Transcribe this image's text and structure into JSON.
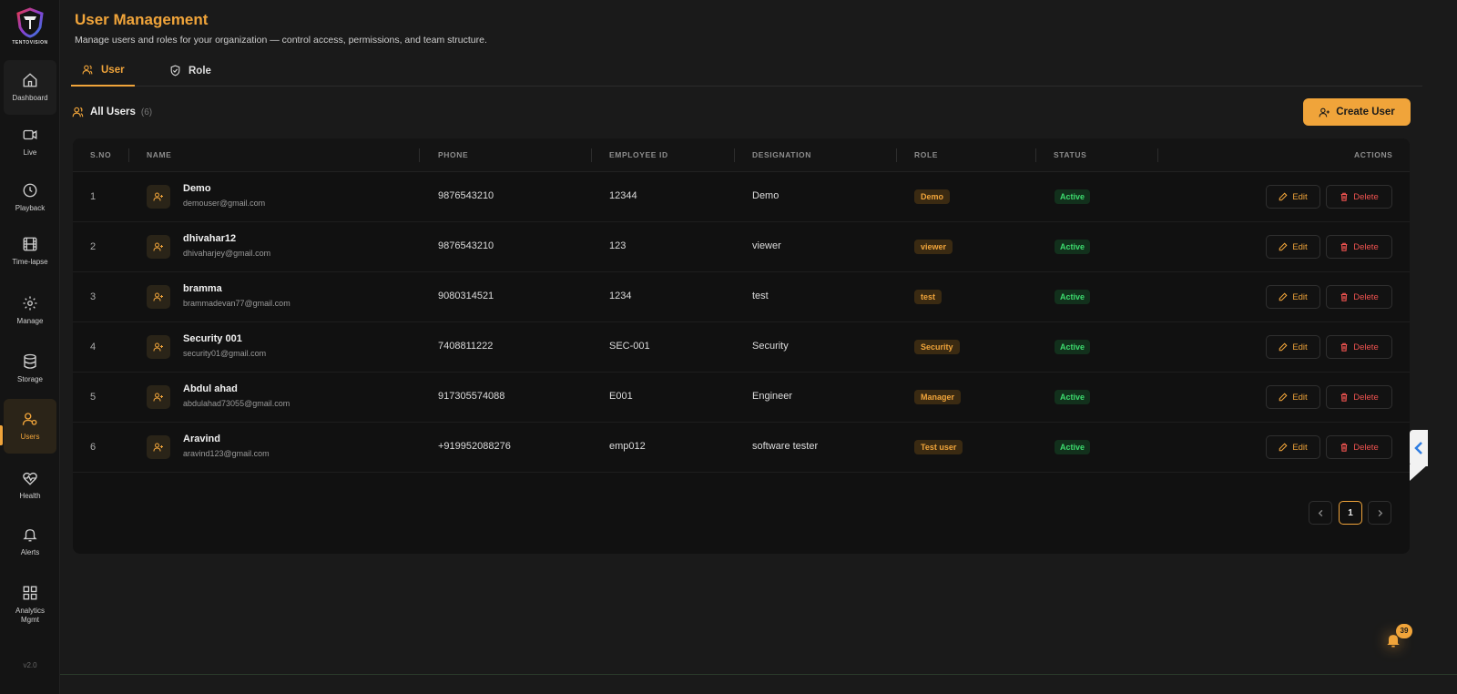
{
  "brand": {
    "logo_text": "TENTOVISION",
    "version": "v2.0"
  },
  "nav": [
    {
      "label": "Dashboard",
      "icon": "home-icon"
    },
    {
      "label": "Live",
      "icon": "video-icon"
    },
    {
      "label": "Playback",
      "icon": "clock-icon"
    },
    {
      "label": "Time-lapse",
      "icon": "film-icon"
    },
    {
      "label": "Manage",
      "icon": "gear-icon"
    },
    {
      "label": "Storage",
      "icon": "database-icon"
    },
    {
      "label": "Users",
      "icon": "users-icon"
    },
    {
      "label": "Health",
      "icon": "heart-pulse-icon"
    },
    {
      "label": "Alerts",
      "icon": "bell-icon"
    },
    {
      "label": "Analytics Mgmt",
      "icon": "grid-icon"
    }
  ],
  "header": {
    "title": "User Management",
    "subtitle": "Manage users and roles for your organization — control access, permissions, and team structure."
  },
  "tabs": {
    "user": "User",
    "role": "Role"
  },
  "list": {
    "heading": "All Users",
    "count": "(6)",
    "create_label": "Create User"
  },
  "columns": {
    "sno": "S.NO",
    "name": "NAME",
    "phone": "PHONE",
    "employee_id": "EMPLOYEE ID",
    "designation": "DESIGNATION",
    "role": "ROLE",
    "status": "STATUS",
    "actions": "ACTIONS"
  },
  "actions": {
    "edit": "Edit",
    "delete": "Delete"
  },
  "users": [
    {
      "sno": "1",
      "name": "Demo",
      "email": "demouser@gmail.com",
      "phone": "9876543210",
      "employee_id": "12344",
      "designation": "Demo",
      "role": "Demo",
      "status": "Active"
    },
    {
      "sno": "2",
      "name": "dhivahar12",
      "email": "dhivaharjey@gmail.com",
      "phone": "9876543210",
      "employee_id": "123",
      "designation": "viewer",
      "role": "viewer",
      "status": "Active"
    },
    {
      "sno": "3",
      "name": "bramma",
      "email": "brammadevan77@gmail.com",
      "phone": "9080314521",
      "employee_id": "1234",
      "designation": "test",
      "role": "test",
      "status": "Active"
    },
    {
      "sno": "4",
      "name": "Security 001",
      "email": "security01@gmail.com",
      "phone": "7408811222",
      "employee_id": "SEC-001",
      "designation": "Security",
      "role": "Security",
      "status": "Active"
    },
    {
      "sno": "5",
      "name": "Abdul ahad",
      "email": "abdulahad73055@gmail.com",
      "phone": "917305574088",
      "employee_id": "E001",
      "designation": "Engineer",
      "role": "Manager",
      "status": "Active"
    },
    {
      "sno": "6",
      "name": "Aravind",
      "email": "aravind123@gmail.com",
      "phone": "+919952088276",
      "employee_id": "emp012",
      "designation": "software tester",
      "role": "Test user",
      "status": "Active"
    }
  ],
  "pagination": {
    "current": "1"
  },
  "notifications": {
    "count": "39"
  },
  "colors": {
    "accent": "#f0a43a",
    "active_green": "#3ddc6e",
    "danger": "#ef5350",
    "background": "#1a1a1a"
  }
}
